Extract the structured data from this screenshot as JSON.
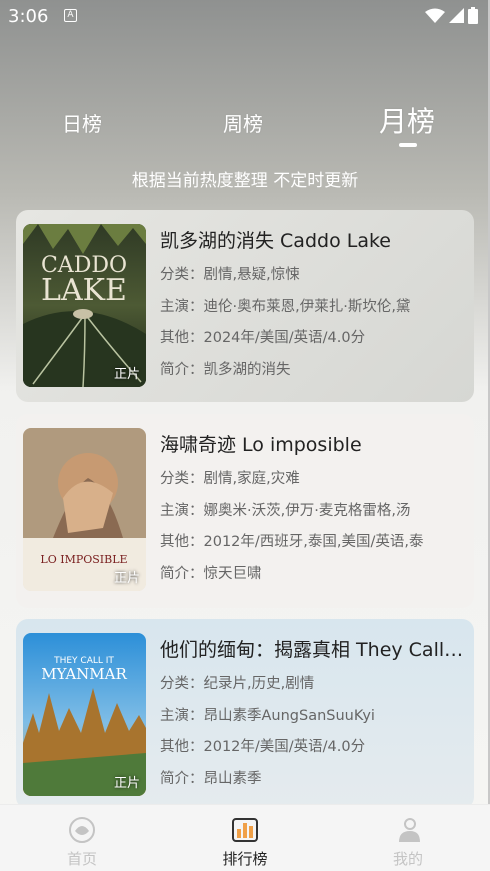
{
  "status_bar": {
    "time": "3:06",
    "app_icon": "A"
  },
  "tabs": [
    {
      "label": "日榜",
      "active": false
    },
    {
      "label": "周榜",
      "active": false
    },
    {
      "label": "月榜",
      "active": true
    }
  ],
  "subtitle": "根据当前热度整理 不定时更新",
  "movies": [
    {
      "title": "凯多湖的消失 Caddo Lake",
      "genre": "分类：剧情,悬疑,惊悚",
      "cast": "主演：迪伦·奥布莱恩,伊莱扎·斯坎伦,黛",
      "other": "其他：2024年/美国/英语/4.0分",
      "summary": "简介：凯多湖的消失",
      "badge": "正片",
      "poster_text": [
        "CADDO",
        "LAKE"
      ]
    },
    {
      "title": "海啸奇迹 Lo imposible",
      "genre": "分类：剧情,家庭,灾难",
      "cast": "主演：娜奥米·沃茨,伊万·麦克格雷格,汤",
      "other": "其他：2012年/西班牙,泰国,美国/英语,泰",
      "summary": "简介：惊天巨啸",
      "badge": "正片",
      "poster_text": [
        "LO IMPOSIBLE"
      ]
    },
    {
      "title": "他们的缅甸：揭露真相 They Call It Myanmar",
      "genre": "分类：纪录片,历史,剧情",
      "cast": "主演：昂山素季AungSanSuuKyi",
      "other": "其他：2012年/美国/英语/4.0分",
      "summary": "简介：昂山素季",
      "badge": "正片",
      "poster_text": [
        "THEY CALL IT",
        "MYANMAR"
      ]
    }
  ],
  "bottom_nav": [
    {
      "label": "首页",
      "icon": "home-icon",
      "active": false
    },
    {
      "label": "排行榜",
      "icon": "ranking-icon",
      "active": true
    },
    {
      "label": "我的",
      "icon": "profile-icon",
      "active": false
    }
  ],
  "colors": {
    "active_text": "#222222",
    "inactive_nav": "#c4c4c4",
    "tab_text": "#ffffff",
    "rank_icon_accent": "#f0a048"
  }
}
